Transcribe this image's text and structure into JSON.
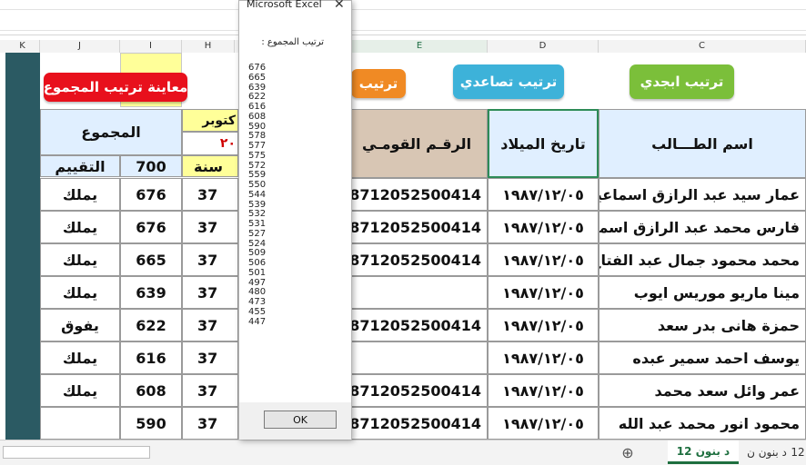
{
  "columns": [
    "K",
    "J",
    "I",
    "H",
    "E",
    "D",
    "C"
  ],
  "buttons": {
    "preview_sort_total": "معاينة ترتيب المجموع",
    "sort": "ترتيب",
    "sort_ascending": "ترتيب تصاعدي",
    "sort_alphabetical": "ترتيب ابجدي"
  },
  "colors": {
    "red_button": "#e8101c",
    "orange_button": "#f08a24",
    "blue_button": "#3db2d9",
    "green_button": "#7bbf3a",
    "teal_column": "#2b5a63"
  },
  "headers": {
    "total": "المجموع",
    "october": "كتوبر",
    "year_partial": "٢٠",
    "max_score": "700",
    "grade": "التقييم",
    "year": "سنة",
    "national_id": "الرقـم القومـي",
    "birth_date": "تاريخ الميلاد",
    "student_name": "اسم الطـــالب"
  },
  "rows": [
    {
      "grade": "يملك",
      "total": "676",
      "age": "37",
      "national_id": "8712052500414",
      "birth_date": "١٩٨٧/١٢/٠٥",
      "name": "عمار سيد عبد الرازق اسماعيل"
    },
    {
      "grade": "يملك",
      "total": "676",
      "age": "37",
      "national_id": "8712052500414",
      "birth_date": "١٩٨٧/١٢/٠٥",
      "name": "فارس محمد عبد الرازق اسماعيل"
    },
    {
      "grade": "يملك",
      "total": "665",
      "age": "37",
      "national_id": "8712052500414",
      "birth_date": "١٩٨٧/١٢/٠٥",
      "name": "محمد محمود جمال عبد الفتاح"
    },
    {
      "grade": "يملك",
      "total": "639",
      "age": "37",
      "national_id": "",
      "birth_date": "١٩٨٧/١٢/٠٥",
      "name": "مينا ماريو موريس ايوب"
    },
    {
      "grade": "يفوق",
      "total": "622",
      "age": "37",
      "national_id": "8712052500414",
      "birth_date": "١٩٨٧/١٢/٠٥",
      "name": "حمزة هانى بدر سعد"
    },
    {
      "grade": "يملك",
      "total": "616",
      "age": "37",
      "national_id": "",
      "birth_date": "١٩٨٧/١٢/٠٥",
      "name": "يوسف احمد سمير عبده"
    },
    {
      "grade": "يملك",
      "total": "608",
      "age": "37",
      "national_id": "8712052500414",
      "birth_date": "١٩٨٧/١٢/٠٥",
      "name": "عمر وائل سعد محمد"
    },
    {
      "grade": "",
      "total": "590",
      "age": "37",
      "national_id": "8712052500414",
      "birth_date": "١٩٨٧/١٢/٠٥",
      "name": "محمود انور محمد عبد الله"
    }
  ],
  "dialog": {
    "title": "Microsoft Excel",
    "close": "✕",
    "heading": "ترتيب المجموع :",
    "values": [
      "676",
      "665",
      "639",
      "622",
      "616",
      "608",
      "590",
      "578",
      "577",
      "575",
      "572",
      "559",
      "550",
      "544",
      "539",
      "532",
      "531",
      "527",
      "524",
      "509",
      "506",
      "501",
      "497",
      "480",
      "473",
      "455",
      "447"
    ],
    "ok": "OK"
  },
  "sheet_tabs": {
    "add_icon": "⊕",
    "active": "12 د بنون",
    "next": "د بنون ن",
    "partial": "12"
  }
}
